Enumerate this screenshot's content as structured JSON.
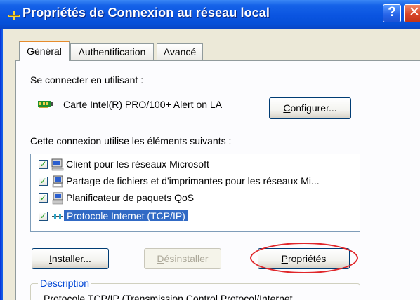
{
  "window": {
    "title": "Propriétés de Connexion au réseau local",
    "help_label": "?",
    "close_label": "✕"
  },
  "tabs": [
    {
      "label": "Général",
      "active": true
    },
    {
      "label": "Authentification",
      "active": false
    },
    {
      "label": "Avancé",
      "active": false
    }
  ],
  "general": {
    "connect_using_label": "Se connecter en utilisant :",
    "adapter_name": "Carte Intel(R) PRO/100+ Alert on LA",
    "configure_button": {
      "accel": "C",
      "rest": "onfigurer..."
    },
    "elements_label": "Cette connexion utilise les éléments suivants :",
    "items": [
      {
        "label": "Client pour les réseaux Microsoft",
        "checked": true,
        "selected": false,
        "icon": "network-client-icon"
      },
      {
        "label": "Partage de fichiers et d'imprimantes pour les réseaux Mi...",
        "checked": true,
        "selected": false,
        "icon": "file-printer-sharing-icon"
      },
      {
        "label": "Planificateur de paquets QoS",
        "checked": true,
        "selected": false,
        "icon": "qos-scheduler-icon"
      },
      {
        "label": "Protocole Internet (TCP/IP)",
        "checked": true,
        "selected": true,
        "icon": "protocol-icon"
      }
    ],
    "install_button": {
      "accel": "I",
      "rest": "nstaller..."
    },
    "uninstall_button": {
      "accel": "D",
      "rest": "ésinstaller",
      "enabled": false
    },
    "properties_button": {
      "accel": "P",
      "rest": "ropriétés"
    },
    "description_label": "Description",
    "description_text": "Protocole TCP/IP (Transmission Control Protocol/Internet"
  },
  "colors": {
    "titlebar": "#0a54e0",
    "dialog_bg": "#ece9d8",
    "selection": "#316ac5",
    "annotation_circle": "#e0262a",
    "active_tab_accent": "#e68b2c"
  }
}
